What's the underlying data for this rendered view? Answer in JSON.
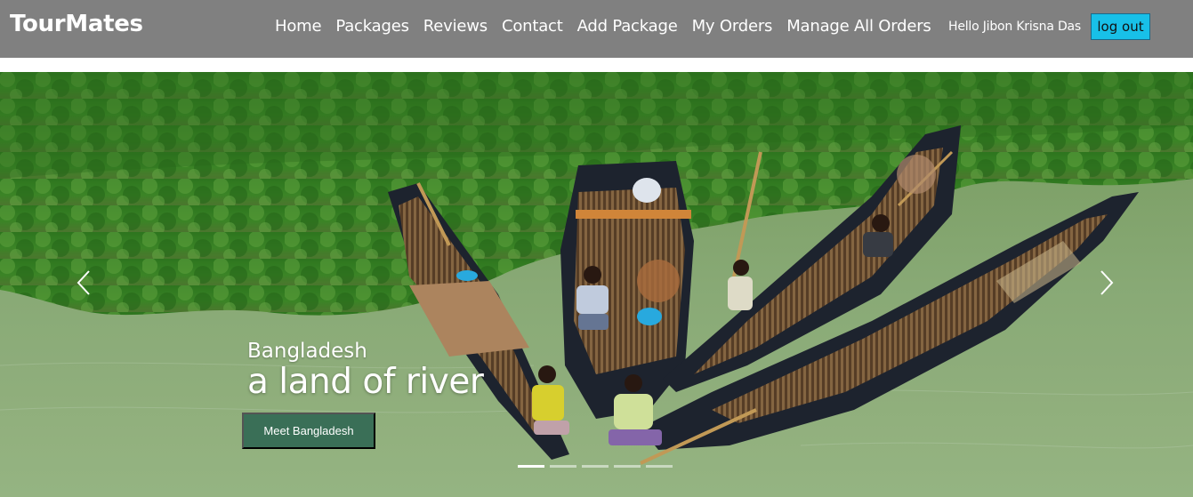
{
  "brand": "TourMates",
  "nav": {
    "items": [
      {
        "label": "Home"
      },
      {
        "label": "Packages"
      },
      {
        "label": "Reviews"
      },
      {
        "label": "Contact"
      },
      {
        "label": "Add Package"
      },
      {
        "label": "My Orders"
      },
      {
        "label": "Manage All Orders"
      }
    ],
    "greeting": "Hello Jibon Krisna Das",
    "logout_label": "log out"
  },
  "carousel": {
    "caption_small": "Bangladesh",
    "caption_big": "a land of river",
    "cta_label": "Meet Bangladesh",
    "indicator_count": 5,
    "active_index": 0
  },
  "colors": {
    "navbar_bg": "#808080",
    "logout_bg": "#18c0e8",
    "cta_bg": "#3a6f57"
  },
  "icons": {
    "prev": "chevron-left-icon",
    "next": "chevron-right-icon"
  }
}
